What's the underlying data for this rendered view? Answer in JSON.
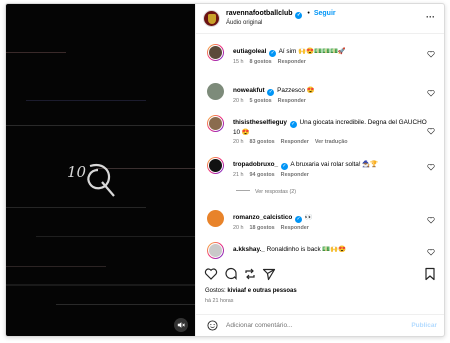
{
  "post": {
    "username": "ravennafootballclub",
    "follow_label": "Seguir",
    "dot": "•",
    "audio": "Áudio original"
  },
  "video": {
    "overlay_text": "10"
  },
  "comments": [
    {
      "user": "eutiagoleal",
      "text": "Aí sim 🙌😍💵💵💵🚀",
      "time": "15 h",
      "likes": "8 gostos",
      "reply": "Responder",
      "extra": ""
    },
    {
      "user": "noweakfut",
      "text": "Pazzesco 😍",
      "time": "20 h",
      "likes": "5 gostos",
      "reply": "Responder",
      "extra": ""
    },
    {
      "user": "thisistheselfieguy",
      "text": "Una giocata incredibile. Degna del GAUCHO 10 😍",
      "time": "20 h",
      "likes": "83 gostos",
      "reply": "Responder",
      "extra": "Ver tradução"
    },
    {
      "user": "tropadobruxo_",
      "text": "A bruxaria vai rolar solta! 🧙🏾‍♂️🏆",
      "time": "21 h",
      "likes": "94 gostos",
      "reply": "Responder",
      "extra": ""
    },
    {
      "user": "romanzo_calcistico",
      "text": "👀",
      "time": "20 h",
      "likes": "18 gostos",
      "reply": "Responder",
      "extra": ""
    },
    {
      "user": "a.kkshay._",
      "text": "Ronaldinho is back 💵🙌😍",
      "time": "",
      "likes": "",
      "reply": "",
      "extra": ""
    }
  ],
  "view_replies": "Ver respostas (2)",
  "footer": {
    "likes_prefix": "Gostos: ",
    "likes_user": "kiviaaf",
    "likes_suffix": " e outras pessoas",
    "posted": "há 21 horas",
    "comment_placeholder": "Adicionar comentário...",
    "publish_label": "Publicar"
  },
  "icons": {
    "more": "more-horizontal-icon",
    "like": "heart-icon",
    "comment": "comment-bubble-icon",
    "repost": "repost-icon",
    "share": "send-icon",
    "save": "bookmark-icon",
    "emoji": "smiley-icon",
    "mute": "speaker-muted-icon",
    "verified": "verified-badge-icon"
  },
  "colors": {
    "link_blue": "#0095f6",
    "muted_gray": "#737373",
    "video_bg": "#050505"
  }
}
